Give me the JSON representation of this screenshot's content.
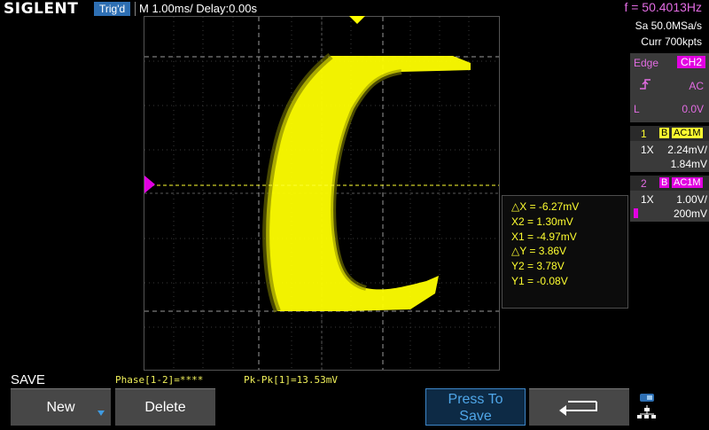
{
  "header": {
    "brand": "SIGLENT",
    "trigger_status": "Trig'd",
    "timebase": "M 1.00ms/ Delay:0.00s",
    "frequency": "f = 50.4013Hz"
  },
  "acquisition": {
    "sample_rate": "Sa 50.0MSa/s",
    "memory": "Curr 700kpts"
  },
  "trigger": {
    "type_label": "Edge",
    "source": "CH2",
    "coupling": "AC",
    "level_label": "L",
    "level": "0.0V"
  },
  "channels": [
    {
      "number": "1",
      "bw_badge": "B",
      "coupling": "AC1M",
      "probe": "1X",
      "offset": "2.24mV/",
      "scale": "1.84mV"
    },
    {
      "number": "2",
      "bw_badge": "B",
      "coupling": "AC1M",
      "probe": "1X",
      "offset": "1.00V/",
      "scale": "200mV"
    }
  ],
  "cursors": {
    "lines": [
      "△X = -6.27mV",
      "X2 = 1.30mV",
      "X1 = -4.97mV",
      "△Y = 3.86V",
      "Y2 = 3.78V",
      "Y1 = -0.08V"
    ]
  },
  "measurements": {
    "phase": "Phase[1-2]=****",
    "pkpk": "Pk-Pk[1]=13.53mV"
  },
  "menu": {
    "title": "SAVE",
    "new_label": "New",
    "delete_label": "Delete",
    "press_save_line1": "Press To",
    "press_save_line2": "Save"
  },
  "colors": {
    "trace": "#ffff00",
    "cursor": "#ffff30",
    "trigger_marker": "#e200e2",
    "accent_blue": "#2e6fb3"
  },
  "icons": [
    "chevron-down-icon",
    "back-arrow-icon",
    "network-icon",
    "trigger-edge-icon"
  ]
}
